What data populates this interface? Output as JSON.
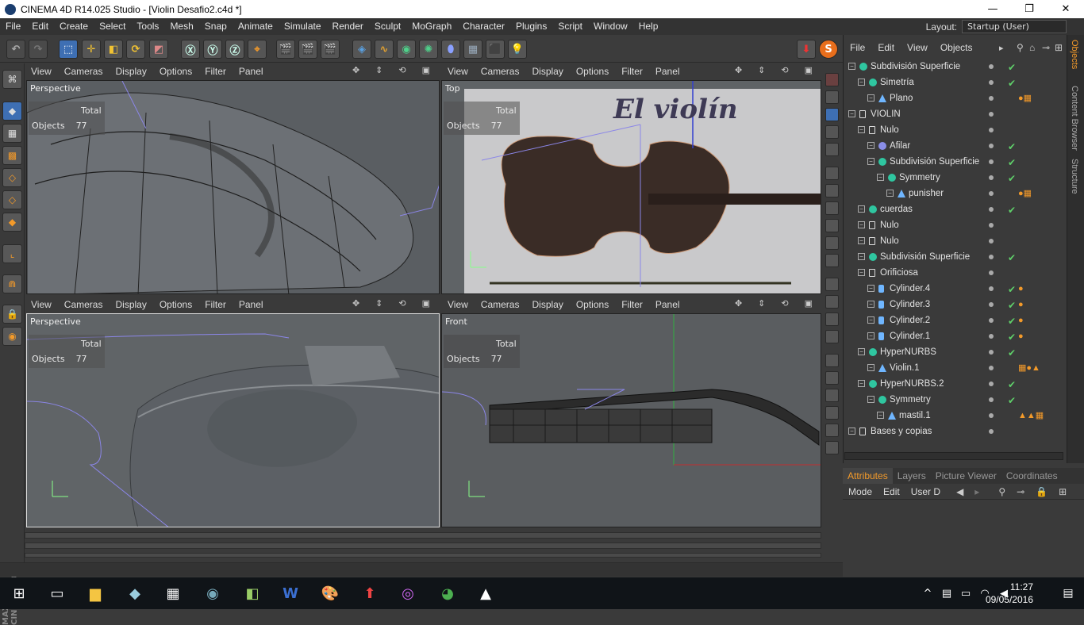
{
  "window": {
    "title": "CINEMA 4D R14.025 Studio - [Violin Desafio2.c4d *]",
    "minimize": "—",
    "maximize": "❐",
    "close": "✕"
  },
  "menu": [
    "File",
    "Edit",
    "Create",
    "Select",
    "Tools",
    "Mesh",
    "Snap",
    "Animate",
    "Simulate",
    "Render",
    "Sculpt",
    "MoGraph",
    "Character",
    "Plugins",
    "Script",
    "Window",
    "Help"
  ],
  "layout": {
    "label": "Layout:",
    "value": "Startup (User)"
  },
  "viewport_menu": [
    "View",
    "Cameras",
    "Display",
    "Options",
    "Filter",
    "Panel"
  ],
  "viewports": [
    {
      "name": "Perspective",
      "total": "Total",
      "objects_label": "Objects",
      "objects": "77"
    },
    {
      "name": "Top",
      "total": "Total",
      "objects_label": "Objects",
      "objects": "77",
      "overlay_text": "El violín"
    },
    {
      "name": "Perspective",
      "total": "Total",
      "objects_label": "Objects",
      "objects": "77"
    },
    {
      "name": "Front",
      "total": "Total",
      "objects_label": "Objects",
      "objects": "77"
    }
  ],
  "object_manager": {
    "menu": [
      "File",
      "Edit",
      "View",
      "Objects"
    ],
    "items": [
      {
        "name": "Subdivisión Superficie",
        "depth": 0,
        "icon": "subdiv-icon",
        "check": true,
        "tags": ""
      },
      {
        "name": "Simetría",
        "depth": 1,
        "icon": "symmetry-icon",
        "check": true,
        "tags": ""
      },
      {
        "name": "Plano",
        "depth": 2,
        "icon": "polygon-icon",
        "check": false,
        "tags": "●▦"
      },
      {
        "name": "VIOLIN",
        "depth": 0,
        "icon": "null-icon",
        "check": false,
        "tags": ""
      },
      {
        "name": "Nulo",
        "depth": 1,
        "icon": "null-icon",
        "check": false,
        "tags": ""
      },
      {
        "name": "Afilar",
        "depth": 2,
        "icon": "deformer-icon",
        "check": true,
        "tags": ""
      },
      {
        "name": "Subdivisión Superficie",
        "depth": 2,
        "icon": "subdiv-icon",
        "check": true,
        "tags": ""
      },
      {
        "name": "Symmetry",
        "depth": 3,
        "icon": "symmetry-icon",
        "check": true,
        "tags": ""
      },
      {
        "name": "punisher",
        "depth": 4,
        "icon": "polygon-icon",
        "check": false,
        "tags": "●▦"
      },
      {
        "name": "cuerdas",
        "depth": 1,
        "icon": "symmetry-icon",
        "check": true,
        "tags": ""
      },
      {
        "name": "Nulo",
        "depth": 1,
        "icon": "null-icon",
        "check": false,
        "tags": ""
      },
      {
        "name": "Nulo",
        "depth": 1,
        "icon": "null-icon",
        "check": false,
        "tags": ""
      },
      {
        "name": "Subdivisión Superficie",
        "depth": 1,
        "icon": "subdiv-icon",
        "check": true,
        "tags": ""
      },
      {
        "name": "Orificiosa",
        "depth": 1,
        "icon": "null-icon",
        "check": false,
        "tags": ""
      },
      {
        "name": "Cylinder.4",
        "depth": 2,
        "icon": "cylinder-icon",
        "check": true,
        "tags": "●"
      },
      {
        "name": "Cylinder.3",
        "depth": 2,
        "icon": "cylinder-icon",
        "check": true,
        "tags": "●"
      },
      {
        "name": "Cylinder.2",
        "depth": 2,
        "icon": "cylinder-icon",
        "check": true,
        "tags": "●"
      },
      {
        "name": "Cylinder.1",
        "depth": 2,
        "icon": "cylinder-icon",
        "check": true,
        "tags": "●"
      },
      {
        "name": "HyperNURBS",
        "depth": 1,
        "icon": "subdiv-icon",
        "check": true,
        "tags": ""
      },
      {
        "name": "Violin.1",
        "depth": 2,
        "icon": "polygon-icon",
        "check": false,
        "tags": "▦●▲"
      },
      {
        "name": "HyperNURBS.2",
        "depth": 1,
        "icon": "subdiv-icon",
        "check": true,
        "tags": ""
      },
      {
        "name": "Symmetry",
        "depth": 2,
        "icon": "symmetry-icon",
        "check": true,
        "tags": ""
      },
      {
        "name": "mastil.1",
        "depth": 3,
        "icon": "polygon-icon",
        "check": false,
        "tags": "▲▲▦"
      },
      {
        "name": "Bases y copias",
        "depth": 0,
        "icon": "null-icon",
        "check": false,
        "tags": ""
      }
    ]
  },
  "side_tabs": [
    "Objects",
    "Content Browser",
    "Structure"
  ],
  "attributes": {
    "tabs": [
      "Attributes",
      "Layers",
      "Picture Viewer",
      "Coordinates"
    ],
    "menu": [
      "Mode",
      "Edit",
      "User D"
    ]
  },
  "taskbar": {
    "time": "11:27",
    "date": "09/05/2016"
  },
  "colors": {
    "accent": "#f39a2a",
    "check": "#5fd06a",
    "viewport_bg": "#5f6366",
    "top_bg": "#c9c9cb"
  }
}
